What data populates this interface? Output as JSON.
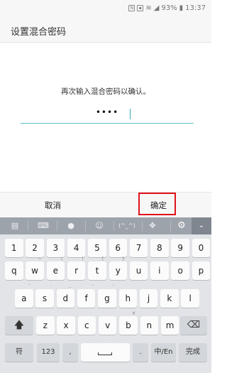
{
  "status_bar": {
    "icons": [
      "nfc-icon",
      "sim-icon",
      "wifi-icon",
      "signal-icon",
      "battery-icon"
    ],
    "battery": "93%",
    "time": "13:37"
  },
  "header": {
    "title": "设置混合密码"
  },
  "content": {
    "prompt": "再次输入混合密码以确认。",
    "password_masked": "••••"
  },
  "actions": {
    "cancel": "取消",
    "confirm": "确定",
    "highlight_color": "#e0121b"
  },
  "keyboard": {
    "toolbar_icons": [
      "clipboard-icon",
      "keyboard-icon",
      "mic-icon",
      "emoji-icon",
      "kaomoji-icon",
      "move-cursor-icon",
      "settings-icon",
      "collapse-icon"
    ],
    "kaomoji_label": "(^_^)",
    "row1": [
      "1",
      "2",
      "3",
      "4",
      "5",
      "6",
      "7",
      "8",
      "9",
      "0"
    ],
    "row2": {
      "keys": [
        "q",
        "w",
        "e",
        "r",
        "t",
        "y",
        "u",
        "i",
        "o",
        "p"
      ],
      "subs": [
        "",
        "~",
        "\\",
        "|",
        "{",
        "}",
        "",
        "",
        "",
        ""
      ]
    },
    "row3": {
      "keys": [
        "a",
        "s",
        "d",
        "f",
        "g",
        "h",
        "j",
        "k",
        "l"
      ],
      "subs": [
        "`",
        "·",
        "...",
        "‘",
        "'",
        "",
        "",
        "",
        ""
      ]
    },
    "row4": {
      "keys": [
        "z",
        "x",
        "c",
        "v",
        "b",
        "n",
        "m"
      ],
      "subs": [
        "",
        "",
        "",
        "",
        "¥",
        "",
        ""
      ]
    },
    "row5": {
      "symbols": "符",
      "numbers": "123",
      "comma": ",",
      "period": ".",
      "lang": "中/En",
      "done": "完成"
    },
    "accent": "#5fc2c6"
  }
}
